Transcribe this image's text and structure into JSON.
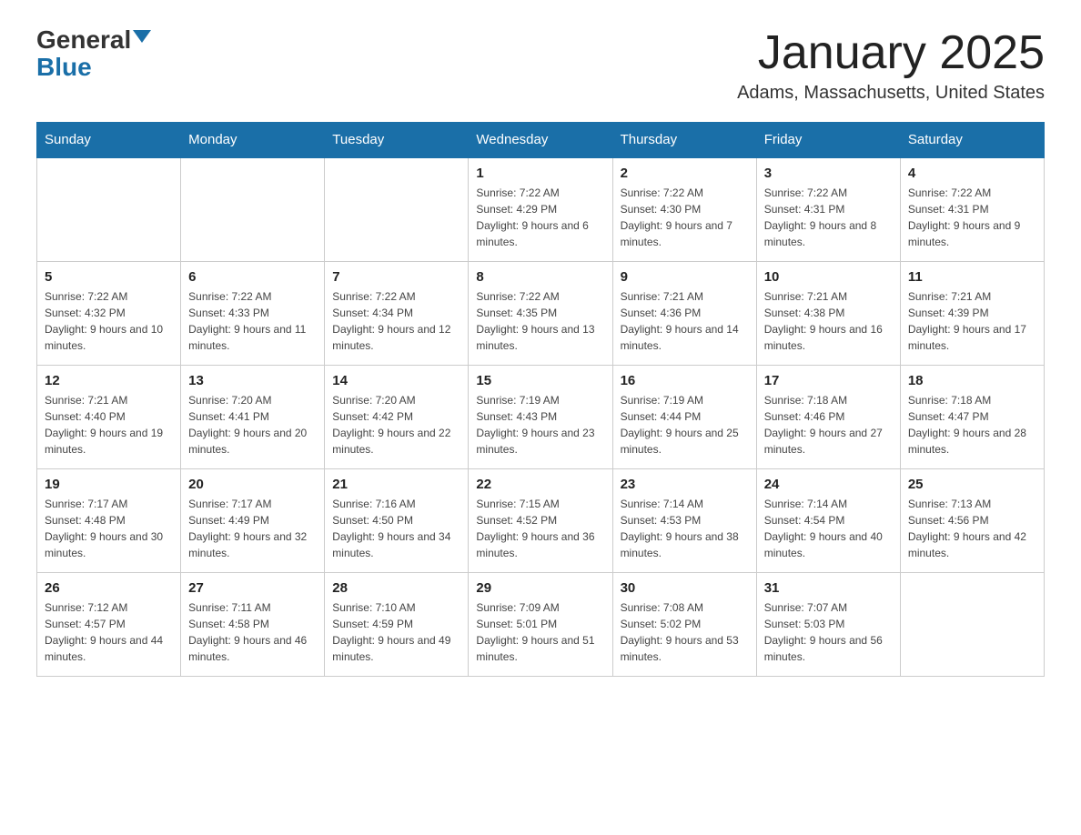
{
  "header": {
    "logo_text_general": "General",
    "logo_text_blue": "Blue",
    "title": "January 2025",
    "subtitle": "Adams, Massachusetts, United States"
  },
  "days_of_week": [
    "Sunday",
    "Monday",
    "Tuesday",
    "Wednesday",
    "Thursday",
    "Friday",
    "Saturday"
  ],
  "weeks": [
    [
      {
        "day": "",
        "info": ""
      },
      {
        "day": "",
        "info": ""
      },
      {
        "day": "",
        "info": ""
      },
      {
        "day": "1",
        "info": "Sunrise: 7:22 AM\nSunset: 4:29 PM\nDaylight: 9 hours and 6 minutes."
      },
      {
        "day": "2",
        "info": "Sunrise: 7:22 AM\nSunset: 4:30 PM\nDaylight: 9 hours and 7 minutes."
      },
      {
        "day": "3",
        "info": "Sunrise: 7:22 AM\nSunset: 4:31 PM\nDaylight: 9 hours and 8 minutes."
      },
      {
        "day": "4",
        "info": "Sunrise: 7:22 AM\nSunset: 4:31 PM\nDaylight: 9 hours and 9 minutes."
      }
    ],
    [
      {
        "day": "5",
        "info": "Sunrise: 7:22 AM\nSunset: 4:32 PM\nDaylight: 9 hours and 10 minutes."
      },
      {
        "day": "6",
        "info": "Sunrise: 7:22 AM\nSunset: 4:33 PM\nDaylight: 9 hours and 11 minutes."
      },
      {
        "day": "7",
        "info": "Sunrise: 7:22 AM\nSunset: 4:34 PM\nDaylight: 9 hours and 12 minutes."
      },
      {
        "day": "8",
        "info": "Sunrise: 7:22 AM\nSunset: 4:35 PM\nDaylight: 9 hours and 13 minutes."
      },
      {
        "day": "9",
        "info": "Sunrise: 7:21 AM\nSunset: 4:36 PM\nDaylight: 9 hours and 14 minutes."
      },
      {
        "day": "10",
        "info": "Sunrise: 7:21 AM\nSunset: 4:38 PM\nDaylight: 9 hours and 16 minutes."
      },
      {
        "day": "11",
        "info": "Sunrise: 7:21 AM\nSunset: 4:39 PM\nDaylight: 9 hours and 17 minutes."
      }
    ],
    [
      {
        "day": "12",
        "info": "Sunrise: 7:21 AM\nSunset: 4:40 PM\nDaylight: 9 hours and 19 minutes."
      },
      {
        "day": "13",
        "info": "Sunrise: 7:20 AM\nSunset: 4:41 PM\nDaylight: 9 hours and 20 minutes."
      },
      {
        "day": "14",
        "info": "Sunrise: 7:20 AM\nSunset: 4:42 PM\nDaylight: 9 hours and 22 minutes."
      },
      {
        "day": "15",
        "info": "Sunrise: 7:19 AM\nSunset: 4:43 PM\nDaylight: 9 hours and 23 minutes."
      },
      {
        "day": "16",
        "info": "Sunrise: 7:19 AM\nSunset: 4:44 PM\nDaylight: 9 hours and 25 minutes."
      },
      {
        "day": "17",
        "info": "Sunrise: 7:18 AM\nSunset: 4:46 PM\nDaylight: 9 hours and 27 minutes."
      },
      {
        "day": "18",
        "info": "Sunrise: 7:18 AM\nSunset: 4:47 PM\nDaylight: 9 hours and 28 minutes."
      }
    ],
    [
      {
        "day": "19",
        "info": "Sunrise: 7:17 AM\nSunset: 4:48 PM\nDaylight: 9 hours and 30 minutes."
      },
      {
        "day": "20",
        "info": "Sunrise: 7:17 AM\nSunset: 4:49 PM\nDaylight: 9 hours and 32 minutes."
      },
      {
        "day": "21",
        "info": "Sunrise: 7:16 AM\nSunset: 4:50 PM\nDaylight: 9 hours and 34 minutes."
      },
      {
        "day": "22",
        "info": "Sunrise: 7:15 AM\nSunset: 4:52 PM\nDaylight: 9 hours and 36 minutes."
      },
      {
        "day": "23",
        "info": "Sunrise: 7:14 AM\nSunset: 4:53 PM\nDaylight: 9 hours and 38 minutes."
      },
      {
        "day": "24",
        "info": "Sunrise: 7:14 AM\nSunset: 4:54 PM\nDaylight: 9 hours and 40 minutes."
      },
      {
        "day": "25",
        "info": "Sunrise: 7:13 AM\nSunset: 4:56 PM\nDaylight: 9 hours and 42 minutes."
      }
    ],
    [
      {
        "day": "26",
        "info": "Sunrise: 7:12 AM\nSunset: 4:57 PM\nDaylight: 9 hours and 44 minutes."
      },
      {
        "day": "27",
        "info": "Sunrise: 7:11 AM\nSunset: 4:58 PM\nDaylight: 9 hours and 46 minutes."
      },
      {
        "day": "28",
        "info": "Sunrise: 7:10 AM\nSunset: 4:59 PM\nDaylight: 9 hours and 49 minutes."
      },
      {
        "day": "29",
        "info": "Sunrise: 7:09 AM\nSunset: 5:01 PM\nDaylight: 9 hours and 51 minutes."
      },
      {
        "day": "30",
        "info": "Sunrise: 7:08 AM\nSunset: 5:02 PM\nDaylight: 9 hours and 53 minutes."
      },
      {
        "day": "31",
        "info": "Sunrise: 7:07 AM\nSunset: 5:03 PM\nDaylight: 9 hours and 56 minutes."
      },
      {
        "day": "",
        "info": ""
      }
    ]
  ]
}
